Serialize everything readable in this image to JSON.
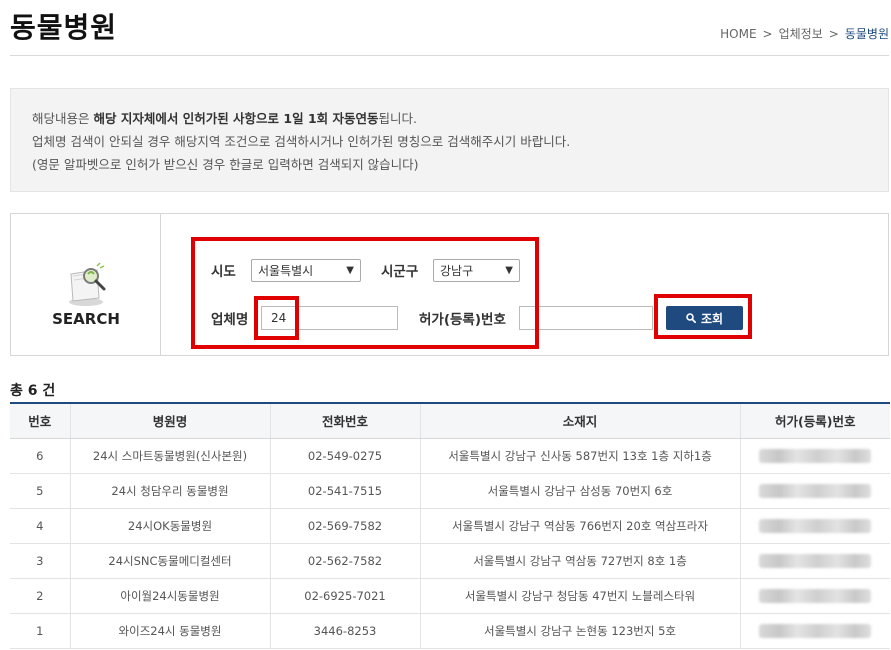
{
  "header": {
    "title": "동물병원",
    "breadcrumb": [
      "HOME",
      "업체정보",
      "동물병원"
    ]
  },
  "notice": {
    "line1_prefix": "해당내용은 ",
    "line1_bold": "해당 지자체에서 인허가된 사항으로 1일 1회 자동연동",
    "line1_suffix": "됩니다.",
    "line2": "업체명 검색이 안되실 경우 해당지역 조건으로 검색하시거나 인허가된 명칭으로 검색해주시기 바랍니다.",
    "line3": "(영문 알파벳으로 인허가 받으신 경우 한글로 입력하면 검색되지 않습니다)"
  },
  "search": {
    "panel_label": "SEARCH",
    "sido_label": "시도",
    "sido_value": "서울특별시",
    "sigungu_label": "시군구",
    "sigungu_value": "강남구",
    "name_label": "업체명",
    "name_value": "24",
    "license_label": "허가(등록)번호",
    "license_value": "",
    "button_label": "조회"
  },
  "results": {
    "count_text": "총 6 건",
    "columns": [
      "번호",
      "병원명",
      "전화번호",
      "소재지",
      "허가(등록)번호"
    ],
    "rows": [
      {
        "no": "6",
        "name": "24시 스마트동물병원(신사본원)",
        "phone": "02-549-0275",
        "address": "서울특별시 강남구 신사동 587번지 13호 1층 지하1층"
      },
      {
        "no": "5",
        "name": "24시 청담우리 동물병원",
        "phone": "02-541-7515",
        "address": "서울특별시 강남구 삼성동 70번지 6호"
      },
      {
        "no": "4",
        "name": "24시OK동물병원",
        "phone": "02-569-7582",
        "address": "서울특별시 강남구 역삼동 766번지 20호 역삼프라자"
      },
      {
        "no": "3",
        "name": "24시SNC동물메디컬센터",
        "phone": "02-562-7582",
        "address": "서울특별시 강남구 역삼동 727번지 8호 1층"
      },
      {
        "no": "2",
        "name": "아이월24시동물병원",
        "phone": "02-6925-7021",
        "address": "서울특별시 강남구 청담동 47번지 노블레스타워"
      },
      {
        "no": "1",
        "name": "와이즈24시 동물병원",
        "phone": "3446-8253",
        "address": "서울특별시 강남구 논현동 123번지 5호"
      }
    ]
  },
  "colors": {
    "accent": "#1e4a80",
    "highlight": "#e10000"
  }
}
